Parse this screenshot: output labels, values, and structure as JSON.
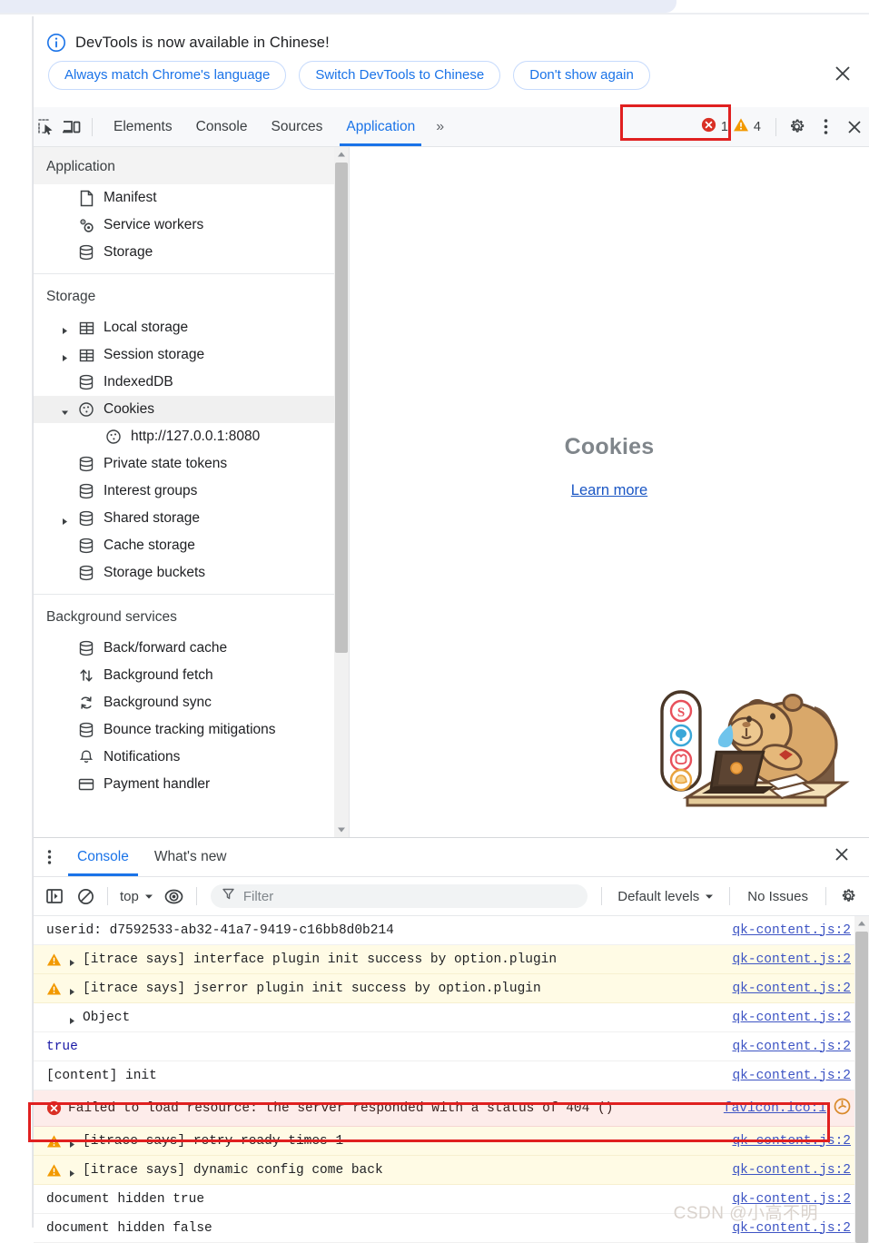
{
  "banner": {
    "message": "DevTools is now available in Chinese!",
    "icon": "info-icon",
    "buttons": [
      {
        "label": "Always match Chrome's language",
        "name": "always-match-language-button"
      },
      {
        "label": "Switch DevTools to Chinese",
        "name": "switch-to-chinese-button"
      },
      {
        "label": "Don't show again",
        "name": "dont-show-again-button"
      }
    ],
    "close_label": "✕"
  },
  "toolbar": {
    "inspect_icon": "inspect-element-icon",
    "device_icon": "device-toolbar-icon",
    "tabs": [
      {
        "label": "Elements",
        "active": false
      },
      {
        "label": "Console",
        "active": false
      },
      {
        "label": "Sources",
        "active": false
      },
      {
        "label": "Application",
        "active": true
      }
    ],
    "more_tabs": "»",
    "error_count": "1",
    "warning_count": "4",
    "settings_icon": "gear-icon",
    "menu_icon": "kebab-menu-icon",
    "close_icon": "close-icon"
  },
  "sidebar": {
    "application_header": "Application",
    "application_items": [
      {
        "label": "Manifest",
        "icon": "manifest-icon"
      },
      {
        "label": "Service workers",
        "icon": "service-worker-icon"
      },
      {
        "label": "Storage",
        "icon": "database-icon"
      }
    ],
    "storage_header": "Storage",
    "storage_items": [
      {
        "label": "Local storage",
        "icon": "table-icon",
        "expandable": true,
        "expanded": false
      },
      {
        "label": "Session storage",
        "icon": "table-icon",
        "expandable": true,
        "expanded": false
      },
      {
        "label": "IndexedDB",
        "icon": "database-icon",
        "expandable": false
      },
      {
        "label": "Cookies",
        "icon": "cookie-icon",
        "expandable": true,
        "expanded": true,
        "selected": true
      },
      {
        "label": "http://127.0.0.1:8080",
        "icon": "cookie-icon",
        "sub": true
      },
      {
        "label": "Private state tokens",
        "icon": "database-icon",
        "expandable": false
      },
      {
        "label": "Interest groups",
        "icon": "database-icon",
        "expandable": false
      },
      {
        "label": "Shared storage",
        "icon": "database-icon",
        "expandable": true,
        "expanded": false
      },
      {
        "label": "Cache storage",
        "icon": "database-icon",
        "expandable": false
      },
      {
        "label": "Storage buckets",
        "icon": "database-icon",
        "expandable": false
      }
    ],
    "background_header": "Background services",
    "background_items": [
      {
        "label": "Back/forward cache",
        "icon": "database-icon"
      },
      {
        "label": "Background fetch",
        "icon": "updown-arrows-icon"
      },
      {
        "label": "Background sync",
        "icon": "sync-icon"
      },
      {
        "label": "Bounce tracking mitigations",
        "icon": "database-icon"
      },
      {
        "label": "Notifications",
        "icon": "bell-icon"
      },
      {
        "label": "Payment handler",
        "icon": "card-icon"
      }
    ]
  },
  "panel": {
    "title": "Cookies",
    "learn_more": "Learn more"
  },
  "drawer": {
    "tabs": [
      {
        "label": "Console",
        "active": true
      },
      {
        "label": "What's new",
        "active": false
      }
    ],
    "close_icon": "close-icon",
    "menu_icon": "kebab-menu-icon"
  },
  "console_toolbar": {
    "sidebar_toggle_icon": "console-sidebar-icon",
    "clear_icon": "clear-console-icon",
    "context": "top",
    "eye_icon": "live-expression-icon",
    "filter_icon": "filter-icon",
    "filter_placeholder": "Filter",
    "filter_value": "",
    "levels": "Default levels",
    "issues": "No Issues",
    "settings_icon": "gear-icon"
  },
  "console_log": {
    "rows": [
      {
        "level": "log",
        "text": "userid: d7592533-ab32-41a7-9419-c16bb8d0b214",
        "source": "qk-content.js:2",
        "caret": false
      },
      {
        "level": "warn",
        "text": "[itrace says] interface plugin init success by option.plugin",
        "source": "qk-content.js:2",
        "caret": true
      },
      {
        "level": "warn",
        "text": "[itrace says] jserror plugin init success by option.plugin",
        "source": "qk-content.js:2",
        "caret": true
      },
      {
        "level": "log",
        "text": "Object",
        "source": "qk-content.js:2",
        "caret": true
      },
      {
        "level": "log",
        "text": "true",
        "source": "qk-content.js:2",
        "caret": false,
        "style": "bool"
      },
      {
        "level": "log",
        "text": "[content] init",
        "source": "qk-content.js:2",
        "caret": false
      },
      {
        "level": "error",
        "text": "Failed to load resource: the server responded with a status of 404 ()",
        "source": "favicon.ico:1",
        "caret": false,
        "trailing_icon": "network-issue-icon"
      },
      {
        "level": "warn",
        "text": "[itrace says] retry ready times 1",
        "source": "qk-content.js:2",
        "caret": true
      },
      {
        "level": "warn",
        "text": "[itrace says] dynamic config come back",
        "source": "qk-content.js:2",
        "caret": true
      },
      {
        "level": "log",
        "text": "document hidden true",
        "source": "qk-content.js:2",
        "caret": false
      },
      {
        "level": "log",
        "text": "document hidden false",
        "source": "qk-content.js:2",
        "caret": false
      }
    ]
  },
  "watermark": "CSDN @小高不明",
  "colors": {
    "accent": "#1a73e8",
    "error": "#d93025",
    "warning": "#f29900",
    "annotation": "#e02020",
    "warn_bg": "#fffbe5",
    "error_bg": "#fdecea"
  }
}
